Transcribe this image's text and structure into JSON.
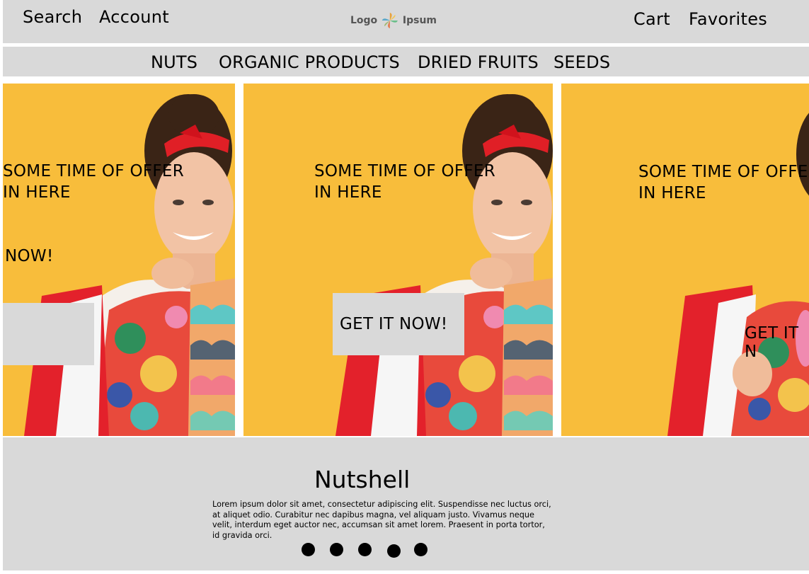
{
  "header": {
    "search_label": "Search",
    "account_label": "Account",
    "cart_label": "Cart",
    "favorites_label": "Favorites",
    "logo_left": "Logo",
    "logo_right": "Ipsum"
  },
  "categories": [
    {
      "label": "NUTS"
    },
    {
      "label": "ORGANIC PRODUCTS"
    },
    {
      "label": "DRIED FRUITS"
    },
    {
      "label": "SEEDS"
    }
  ],
  "banners": [
    {
      "offer_line1": "SOME TIME OF OFFER",
      "offer_line2": "IN HERE",
      "cta_label": "NOW!"
    },
    {
      "offer_line1": "SOME TIME OF OFFER",
      "offer_line2": "IN HERE",
      "cta_label": "GET IT NOW!"
    },
    {
      "offer_line1": "SOME TIME OF OFFE",
      "offer_line2": "IN HERE",
      "cta_label": "GET IT N"
    }
  ],
  "info": {
    "title": "Nutshell",
    "body": "Lorem ipsum dolor sit amet, consectetur adipiscing elit. Suspendisse nec luctus orci, at aliquet odio. Curabitur nec dapibus magna, vel aliquam justo. Vivamus neque velit, interdum eget auctor nec, accumsan sit amet lorem. Praesent in porta tortor, id gravida orci."
  },
  "carousel": {
    "dot_count": 5
  },
  "colors": {
    "banner_bg": "#f8bd3b",
    "bar_bg": "#d9d9d9"
  }
}
